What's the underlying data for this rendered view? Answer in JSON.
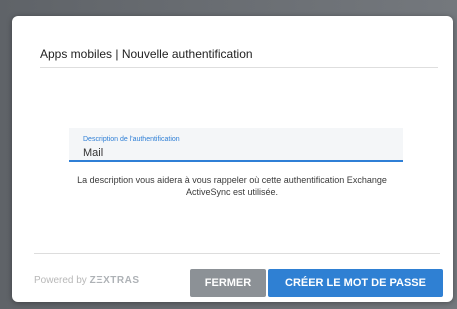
{
  "modal": {
    "title": "Apps mobiles | Nouvelle authentification",
    "field": {
      "label": "Description de l'authentification",
      "value": "Mail"
    },
    "help_text": "La description vous aidera à vous rappeler où cette authentification Exchange ActiveSync est utilisée.",
    "footer": {
      "powered_by": "Powered by",
      "brand": "ZΞXTRAS",
      "buttons": {
        "close": "FERMER",
        "create": "CRÉER LE MOT DE PASSE"
      }
    }
  },
  "colors": {
    "primary": "#2f80d3",
    "secondary": "#8c9196",
    "background": "#ffffff"
  }
}
